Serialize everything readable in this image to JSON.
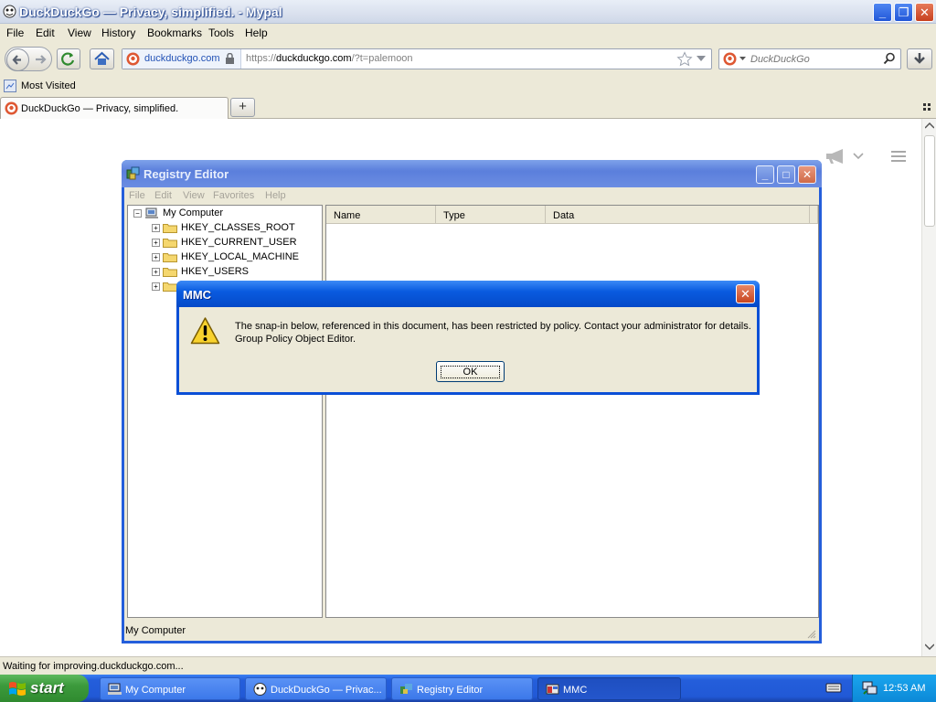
{
  "browser": {
    "title": "DuckDuckGo — Privacy, simplified. - Mypal",
    "menu": [
      "File",
      "Edit",
      "View",
      "History",
      "Bookmarks",
      "Tools",
      "Help"
    ],
    "url_site": "duckduckgo.com",
    "url_prefix": "https://",
    "url_domain": "duckduckgo.com",
    "url_path": "/?t=palemoon",
    "search_placeholder": "DuckDuckGo",
    "bookmark": "Most Visited",
    "tab_title": "DuckDuckGo — Privacy, simplified.",
    "status": "Waiting for improving.duckduckgo.com..."
  },
  "registry": {
    "title": "Registry Editor",
    "menu": [
      "File",
      "Edit",
      "View",
      "Favorites",
      "Help"
    ],
    "tree_root": "My Computer",
    "tree_items": [
      "HKEY_CLASSES_ROOT",
      "HKEY_CURRENT_USER",
      "HKEY_LOCAL_MACHINE",
      "HKEY_USERS"
    ],
    "columns": [
      "Name",
      "Type",
      "Data"
    ],
    "status": "My Computer"
  },
  "dialog": {
    "title": "MMC",
    "message_line1": "The snap-in below, referenced in this document, has been restricted by policy. Contact your administrator for details.",
    "message_line2": "Group Policy Object Editor.",
    "ok": "OK"
  },
  "taskbar": {
    "start": "start",
    "items": [
      "My Computer",
      "DuckDuckGo — Privac...",
      "Registry Editor",
      "MMC"
    ],
    "clock": "12:53 AM"
  },
  "colors": {
    "xp_blue": "#245edb",
    "face": "#ece9d8",
    "start_green": "#3c9a3c"
  }
}
